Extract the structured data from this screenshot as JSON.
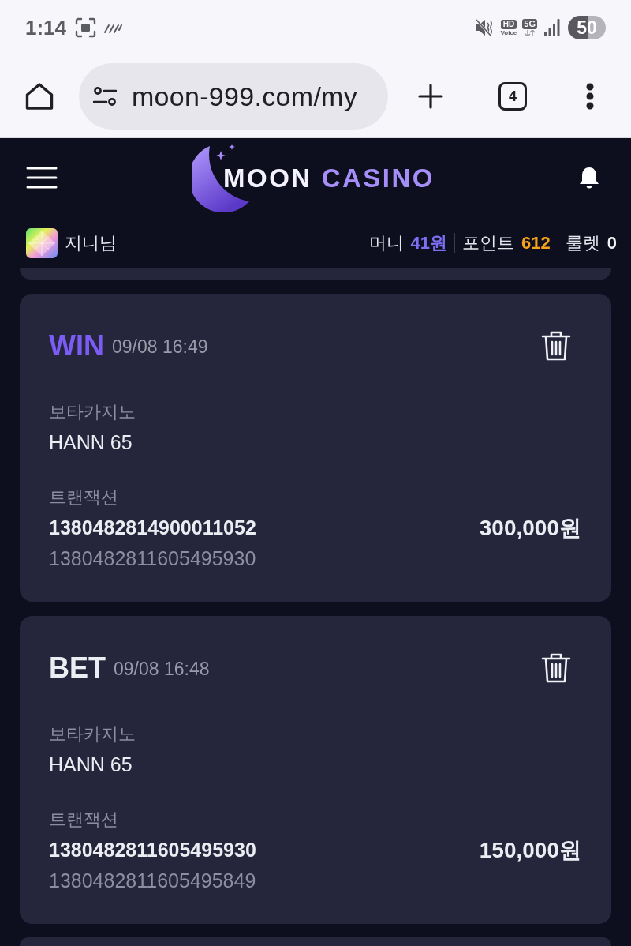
{
  "status_bar": {
    "time": "1:14",
    "hd_voice": {
      "top": "HD",
      "bottom": "Voice"
    },
    "network": "5G",
    "battery": "50"
  },
  "browser_bar": {
    "url": "moon-999.com/my",
    "tab_count": "4"
  },
  "header": {
    "logo_words": [
      {
        "text": "MOON",
        "color": "#f4f2ff"
      },
      {
        "text": "CASINO",
        "color": "#a58ef7"
      }
    ]
  },
  "user_bar": {
    "name": "지니님",
    "stats": [
      {
        "label": "머니",
        "value": "41원",
        "color": "#7d6ff2"
      },
      {
        "label": "포인트",
        "value": "612",
        "color": "#f7a21b"
      },
      {
        "label": "룰렛",
        "value": "0",
        "color": "#f2f2f7"
      }
    ]
  },
  "transactions": [
    {
      "kind": "win",
      "type": "WIN",
      "time": "09/08 16:49",
      "provider": "보타카지노",
      "game": "HANN 65",
      "id_label": "트랜잭션",
      "transaction_id": "1380482814900011052",
      "amount": "300,000원",
      "reference_id": "1380482811605495930"
    },
    {
      "kind": "bet",
      "type": "BET",
      "time": "09/08 16:48",
      "provider": "보타카지노",
      "game": "HANN 65",
      "id_label": "트랜잭션",
      "transaction_id": "1380482811605495930",
      "amount": "150,000원",
      "reference_id": "1380482811605495849"
    }
  ]
}
